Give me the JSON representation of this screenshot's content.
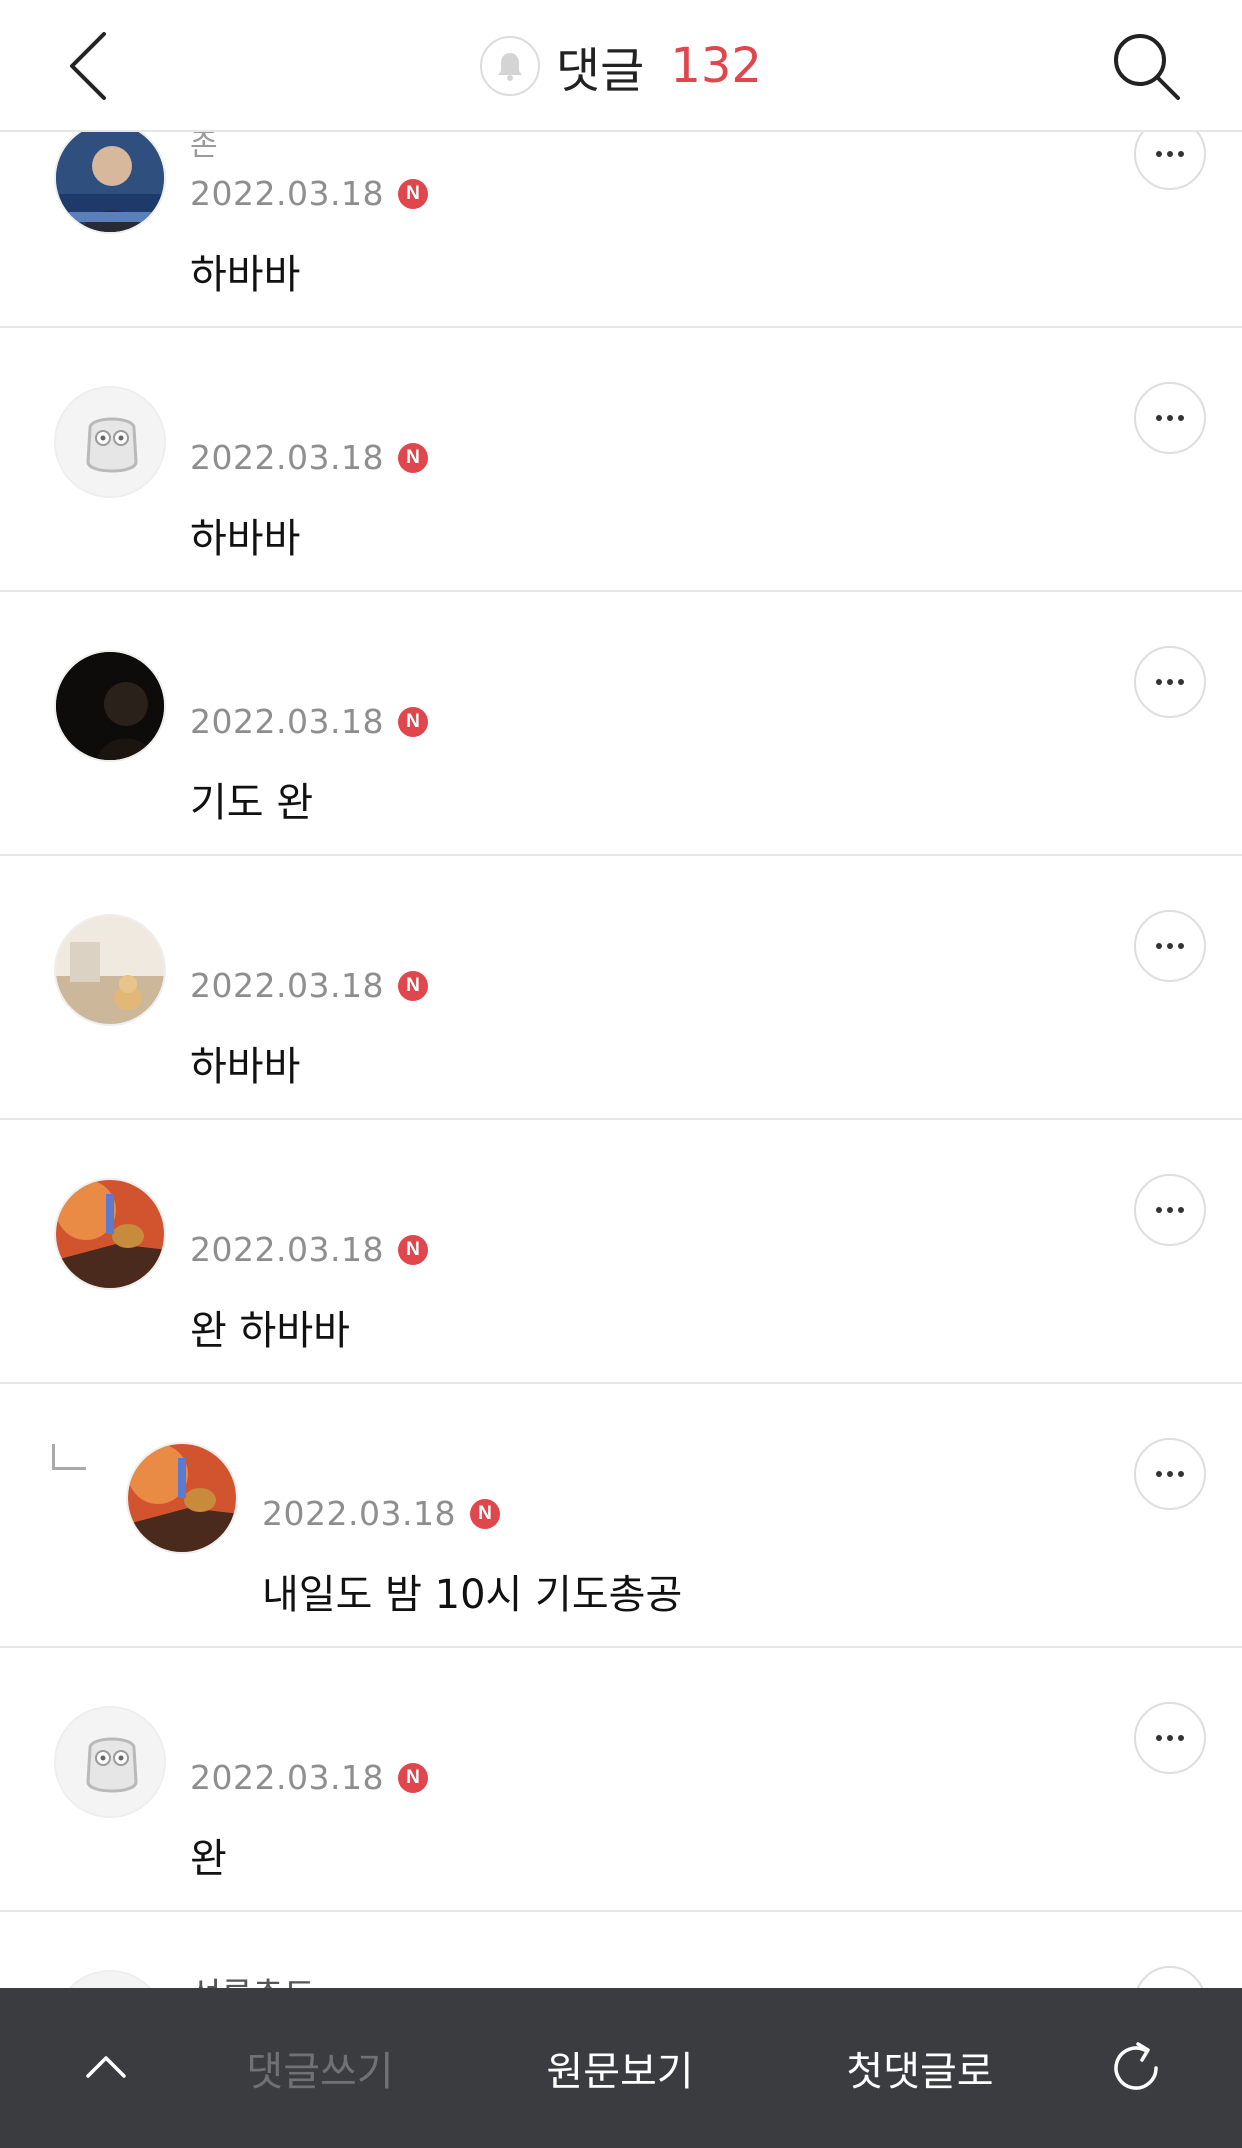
{
  "header": {
    "title": "댓글",
    "count": "132",
    "icons": {
      "back": "chevron-left-icon",
      "bell": "bell-icon",
      "search": "search-icon"
    }
  },
  "comments": [
    {
      "author": "존",
      "date": "2022.03.18",
      "badge": "N",
      "text": "하바바",
      "is_reply": false
    },
    {
      "author": "",
      "date": "2022.03.18",
      "badge": "N",
      "text": "하바바",
      "is_reply": false
    },
    {
      "author": "",
      "date": "2022.03.18",
      "badge": "N",
      "text": "기도 완",
      "is_reply": false
    },
    {
      "author": "",
      "date": "2022.03.18",
      "badge": "N",
      "text": "하바바",
      "is_reply": false
    },
    {
      "author": "",
      "date": "2022.03.18",
      "badge": "N",
      "text": "완 하바바",
      "is_reply": false
    },
    {
      "author": "",
      "date": "2022.03.18",
      "badge": "N",
      "text": "내일도 밤 10시 기도총공",
      "is_reply": true
    },
    {
      "author": "",
      "date": "2022.03.18",
      "badge": "N",
      "text": "완",
      "is_reply": false
    },
    {
      "author": "선룡촉도",
      "date": "",
      "badge": "",
      "text": "",
      "is_reply": false
    }
  ],
  "bottom_bar": {
    "scroll_top_icon": "chevron-up-icon",
    "write_label": "댓글쓰기",
    "original_label": "원문보기",
    "first_comment_label": "첫댓글로",
    "refresh_icon": "refresh-icon"
  },
  "colors": {
    "accent": "#e0474c",
    "bottom_bar": "#3b3c40",
    "disabled_text": "#707176"
  }
}
